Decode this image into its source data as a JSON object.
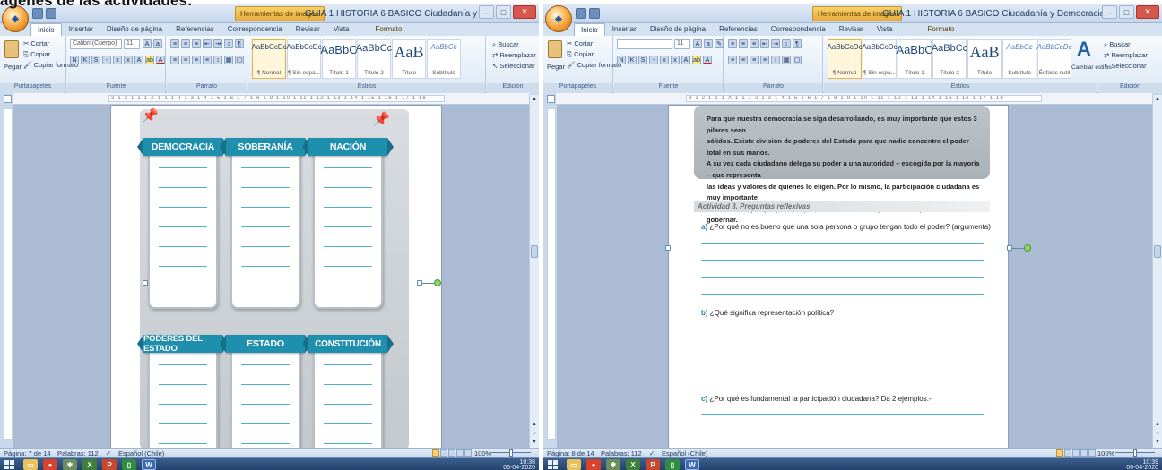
{
  "caption": "ágenes de las actividades:",
  "left": {
    "title": "GUIA 1 HISTORIA 6 BASICO Ciudadanía y Democracia (APRENDIZAJE R...",
    "context_tab": "Herramientas de imagen",
    "tabs": [
      "Inicio",
      "Insertar",
      "Diseño de página",
      "Referencias",
      "Correspondencia",
      "Revisar",
      "Vista",
      "Formato"
    ],
    "font_name": "Calibri (Cuerpo)",
    "font_size": "11",
    "status": {
      "page": "Página: 7 de 14",
      "words": "Palabras: 112",
      "language": "Español (Chile)",
      "zoom": "100%"
    }
  },
  "right": {
    "title": "GUIA 1 HISTORIA 6 BASICO Ciudadanía y Democracia (APRENDIZAJE R...",
    "context_tab": "Herramientas de imagen",
    "tabs": [
      "Inicio",
      "Insertar",
      "Diseño de página",
      "Referencias",
      "Correspondencia",
      "Revisar",
      "Vista",
      "Formato"
    ],
    "font_name": "",
    "font_size": "11",
    "status": {
      "page": "Página: 8 de 14",
      "words": "Palabras: 112",
      "language": "Español (Chile)",
      "zoom": "100%"
    }
  },
  "ribbon": {
    "paste": "Pegar",
    "cut": "Cortar",
    "copy": "Copiar",
    "format_painter": "Copiar formato",
    "groups": {
      "clipboard": "Portapapeles",
      "font": "Fuente",
      "paragraph": "Párrafo",
      "styles": "Estilos",
      "editing": "Edición"
    },
    "styles": [
      {
        "preview": "AaBbCcDc",
        "name": "¶ Normal"
      },
      {
        "preview": "AaBbCcDc",
        "name": "¶ Sin espa..."
      },
      {
        "preview": "AaBbC",
        "name": "Título 1"
      },
      {
        "preview": "AaBbCc",
        "name": "Título 2"
      },
      {
        "preview": "AaB",
        "name": "Título"
      },
      {
        "preview": "AaBbCc",
        "name": "Subtítulo"
      },
      {
        "preview": "AaBbCcDc",
        "name": "Énfasis sutil"
      }
    ],
    "change_styles": "Cambiar estilos",
    "find": "Buscar",
    "replace": "Reemplazar",
    "select": "Seleccionar"
  },
  "worksheet": {
    "concepts": [
      "DEMOCRACIA",
      "SOBERANÍA",
      "NACIÓN",
      "PODERES DEL ESTADO",
      "ESTADO",
      "CONSTITUCIÓN"
    ]
  },
  "reading": {
    "paragraph": [
      "Para que nuestra democracia se siga desarrollando, es muy importante que estos 3 pilares sean",
      "sólidos. Existe división de poderes del Estado para que nadie concentre el poder total en sus manos.",
      "A su vez cada ciudadano delega su poder a una autoridad – escogida por la mayoría – que representa",
      "las ideas y valores de quienes lo eligen. Por lo mismo, la participación ciudadana es muy importante",
      "fundamental, porque por ejemplo, son los votos los que deciden quiénes nos van a gobernar."
    ],
    "activity_heading": "Actividad 3. Preguntas reflexivas",
    "questions": [
      {
        "letter": "a)",
        "text": "¿Por qué no es bueno que una sola persona o grupo tengan todo el poder? (argumenta)"
      },
      {
        "letter": "b)",
        "text": "¿Qué significa representación política?"
      },
      {
        "letter": "c)",
        "text": "¿Por qué es fundamental la participación ciudadana? Da 2 ejemplos.-"
      }
    ]
  },
  "taskbar": {
    "time_left": "10:38",
    "date_left": "06-04-2020",
    "time_right": "10:39",
    "date_right": "06-04-2020"
  },
  "colors": {
    "accent": "#1f8fae",
    "ribbon": "#dde8f4",
    "context_tab": "#e9a93a"
  }
}
